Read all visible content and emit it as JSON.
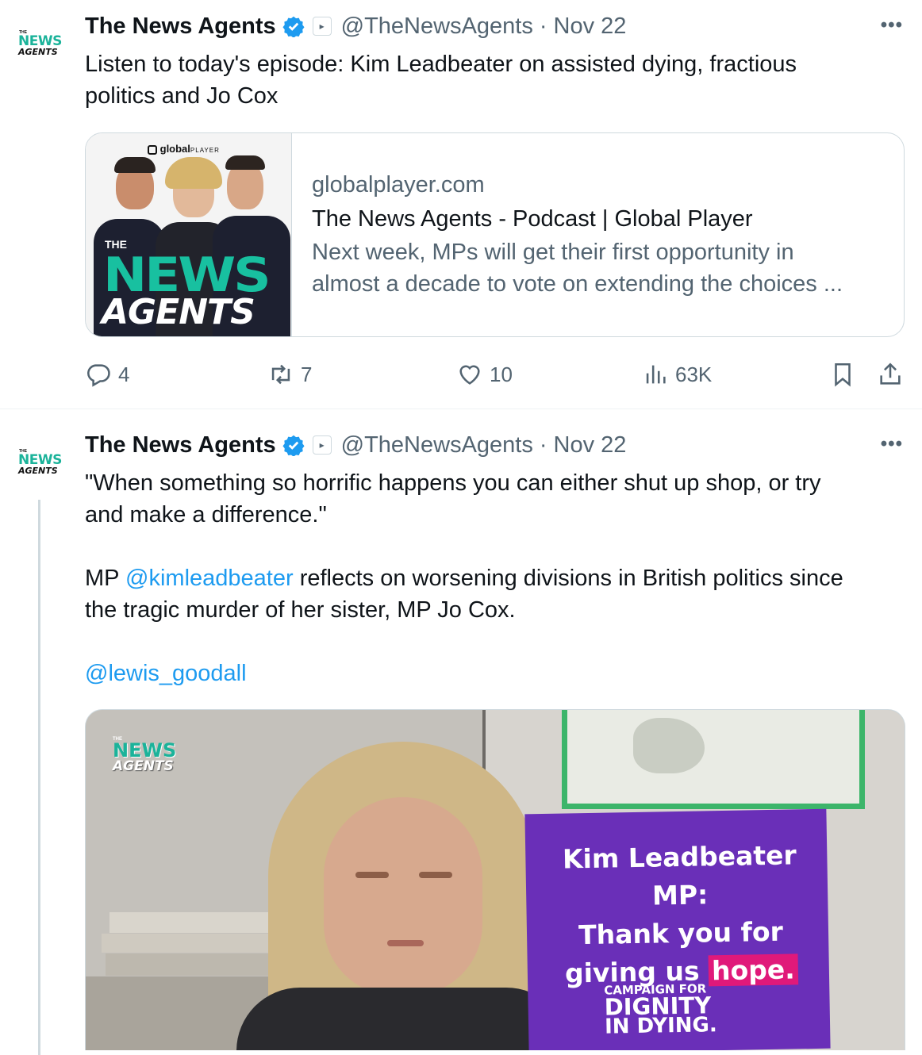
{
  "tweets": [
    {
      "author_name": "The News Agents",
      "handle": "@TheNewsAgents",
      "separator": "·",
      "date": "Nov 22",
      "more": "•••",
      "avatar": {
        "the": "THE",
        "news": "NEWS",
        "agents": "AGENTS"
      },
      "text_lines": [
        "Listen to today's episode: Kim Leadbeater on assisted dying, fractious",
        "politics and Jo Cox"
      ],
      "card": {
        "image_logo": "globalPLAYER",
        "image_logo_main": "global",
        "image_logo_sub": "PLAYER",
        "image_the": "THE",
        "image_news": "NEWS",
        "image_agents": "AGENTS",
        "domain": "globalplayer.com",
        "title": "The News Agents - Podcast | Global Player",
        "description_lines": [
          "Next week, MPs will get their first opportunity in",
          "almost a decade to vote on extending the choices ..."
        ]
      },
      "actions": {
        "replies": "4",
        "reposts": "7",
        "likes": "10",
        "views": "63K"
      }
    },
    {
      "author_name": "The News Agents",
      "handle": "@TheNewsAgents",
      "separator": "·",
      "date": "Nov 22",
      "more": "•••",
      "avatar": {
        "the": "THE",
        "news": "NEWS",
        "agents": "AGENTS"
      },
      "quote_lines": [
        "\"When something so horrific happens you can either shut up shop, or try",
        "and make a difference.\""
      ],
      "body_prefix": "MP ",
      "mention_1": "@kimleadbeater",
      "body_rest_1": " reflects on worsening divisions in British politics since",
      "body_line_2": "the tragic murder of her sister, MP Jo Cox.",
      "mention_2": "@lewis_goodall",
      "media": {
        "watermark_the": "THE",
        "watermark_news": "NEWS",
        "watermark_agents": "AGENTS",
        "sign_line_1": "Kim Leadbeater MP:",
        "sign_line_2": "Thank you for",
        "sign_line_3a": "giving us ",
        "sign_line_3b": "hope.",
        "sign_campaign": "CAMPAIGN FOR",
        "sign_dignity": "DIGNITY",
        "sign_indying": "IN DYING."
      }
    }
  ],
  "colors": {
    "accent": "#1d9bf0",
    "secondary_text": "#536471",
    "border": "#cfd9de",
    "brand_teal": "#18c0a0",
    "sign_purple": "#6a2fb8",
    "sign_pink": "#e0197a"
  },
  "icons": [
    "verified-badge-icon",
    "affiliate-badge-icon",
    "more-icon",
    "reply-icon",
    "repost-icon",
    "like-icon",
    "views-icon",
    "bookmark-icon",
    "share-icon"
  ]
}
